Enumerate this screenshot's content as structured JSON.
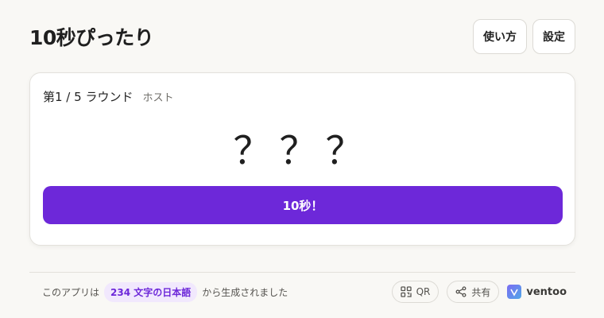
{
  "header": {
    "title": "10秒ぴったり",
    "how_to_label": "使い方",
    "settings_label": "設定"
  },
  "game": {
    "round_label": "第1 / 5 ラウンド",
    "role_label": "ホスト",
    "hidden_time": "？？？",
    "action_label": "10秒！"
  },
  "footer": {
    "prefix": "このアプリは",
    "chip": "234 文字の日本語",
    "suffix": "から生成されました",
    "qr_label": "QR",
    "share_label": "共有",
    "brand_name": "ventoo"
  },
  "colors": {
    "accent": "#6d28d9",
    "chip_bg": "#f1e8fd",
    "background": "#f9f8f5"
  },
  "icons": {
    "qr": "qr-code-icon",
    "share": "share-icon",
    "brand": "ventoo-logo-icon"
  }
}
